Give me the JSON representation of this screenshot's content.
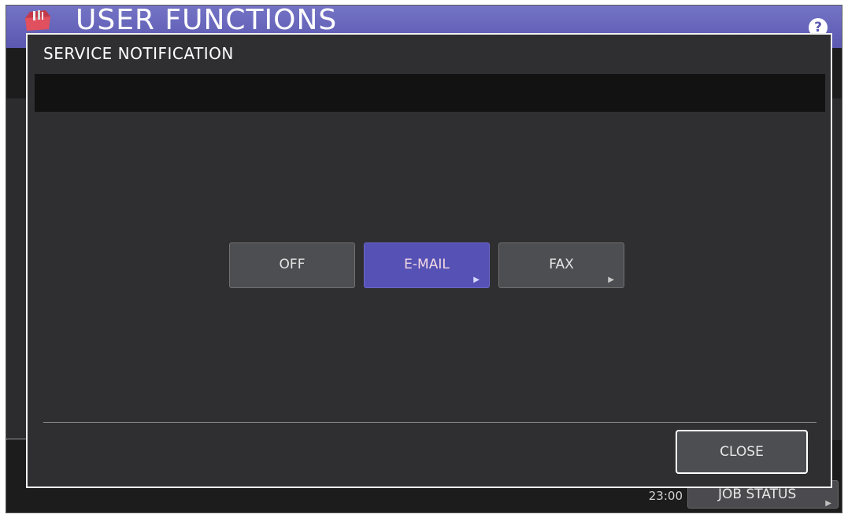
{
  "app": {
    "title": "USER FUNCTIONS",
    "help_label": "?"
  },
  "background": {
    "time": "23:00",
    "job_status_label": "JOB STATUS"
  },
  "dialog": {
    "title": "SERVICE NOTIFICATION",
    "message": "",
    "options": [
      {
        "label": "OFF",
        "selected": false,
        "has_arrow": false
      },
      {
        "label": "E-MAIL",
        "selected": true,
        "has_arrow": true
      },
      {
        "label": "FAX",
        "selected": false,
        "has_arrow": true
      }
    ],
    "close_label": "CLOSE"
  },
  "colors": {
    "title_bar": "#5a58b0",
    "selected_option": "#5652b5",
    "dialog_bg": "#2f2f32"
  },
  "icons": {
    "app_icon": "toolbox-icon",
    "help": "help-icon",
    "option_arrow": "triangle-right-icon"
  }
}
